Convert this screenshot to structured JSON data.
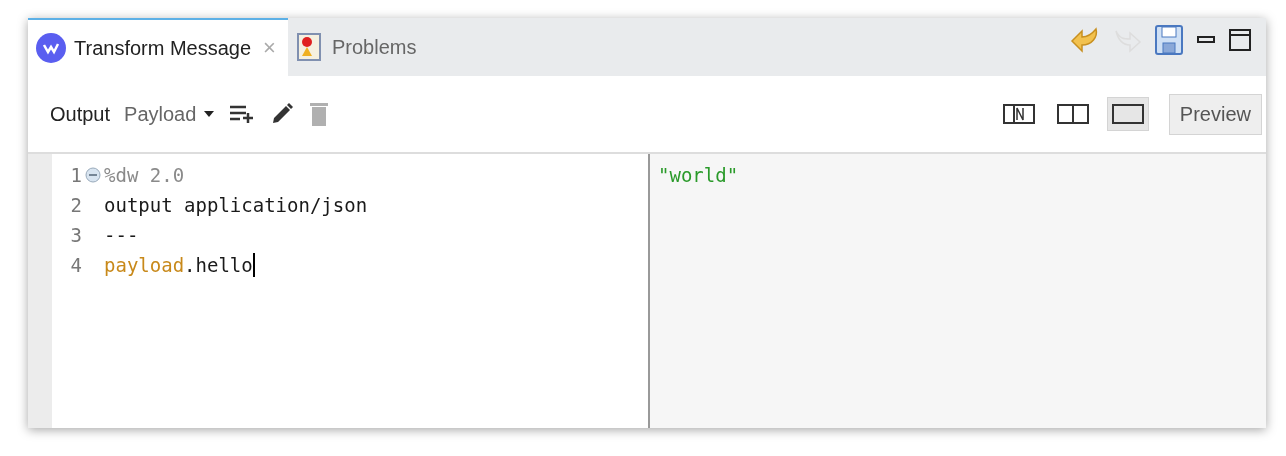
{
  "tabs": [
    {
      "label": "Transform Message",
      "selected": true,
      "close": "×"
    },
    {
      "label": "Problems",
      "selected": false
    }
  ],
  "window_actions": [
    {
      "kind": "undo",
      "disabled": false
    },
    {
      "kind": "redo",
      "disabled": true
    },
    {
      "kind": "save",
      "disabled": false
    },
    {
      "kind": "minimize",
      "disabled": false
    },
    {
      "kind": "maximize",
      "disabled": false
    }
  ],
  "toolbar": {
    "label": "Output",
    "target": "Payload",
    "actions": [
      {
        "kind": "add",
        "disabled": false
      },
      {
        "kind": "edit",
        "disabled": false
      },
      {
        "kind": "delete",
        "disabled": true
      }
    ],
    "layouts": [
      {
        "kind": "source-only",
        "selected": false
      },
      {
        "kind": "split",
        "selected": false
      },
      {
        "kind": "single",
        "selected": true
      }
    ],
    "preview": "Preview"
  },
  "editor": {
    "lines": [
      {
        "number": "1",
        "foldable": true,
        "cursor": false,
        "tokens": [
          {
            "kind": "directive",
            "text": "%dw 2.0"
          }
        ]
      },
      {
        "number": "2",
        "foldable": false,
        "cursor": false,
        "tokens": [
          {
            "kind": "plain",
            "text": "output application/json"
          }
        ]
      },
      {
        "number": "3",
        "foldable": false,
        "cursor": false,
        "tokens": [
          {
            "kind": "plain",
            "text": "---"
          }
        ]
      },
      {
        "number": "4",
        "foldable": false,
        "cursor": true,
        "tokens": [
          {
            "kind": "keyword",
            "text": "payload"
          },
          {
            "kind": "plain",
            "text": ".hello"
          }
        ]
      }
    ]
  },
  "preview": {
    "lines": [
      {
        "kind": "string",
        "text": "\"world\""
      }
    ]
  }
}
